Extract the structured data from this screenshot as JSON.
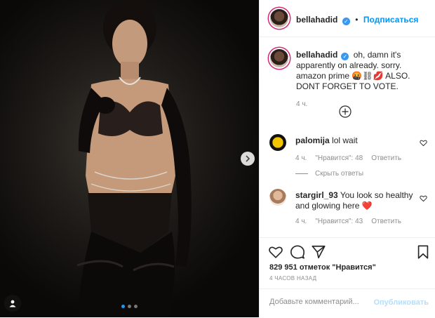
{
  "post": {
    "author": "bellahadid",
    "follow_label": "Подписаться",
    "caption_username": "bellahadid",
    "caption_text": "oh, damn it's apparently on already. sorry. amazon prime 🤬⛓💋 ALSO. DONT FORGET TO VOTE.",
    "caption_time": "4 ч."
  },
  "comments": [
    {
      "username": "palomija",
      "text": "lol wait",
      "time": "4 ч.",
      "likes": "\"Нравится\": 48",
      "reply": "Ответить"
    },
    {
      "username": "stargirl_93",
      "text": "You look so healthy and glowing here ❤️",
      "time": "4 ч.",
      "likes": "\"Нравится\": 43",
      "reply": "Ответить"
    }
  ],
  "replies_toggle": "Скрыть ответы",
  "likes_text": "829 951 отметок \"Нравится\"",
  "posted_ago": "4 ЧАСОВ НАЗАД",
  "comment_box": {
    "placeholder": "Добавьте комментарий...",
    "publish_label": "Опубликовать"
  },
  "carousel": {
    "count": 3,
    "active": 1
  },
  "colors": {
    "link": "#0095f6",
    "verified": "#3897f0",
    "heart_red": "#ed4956"
  }
}
